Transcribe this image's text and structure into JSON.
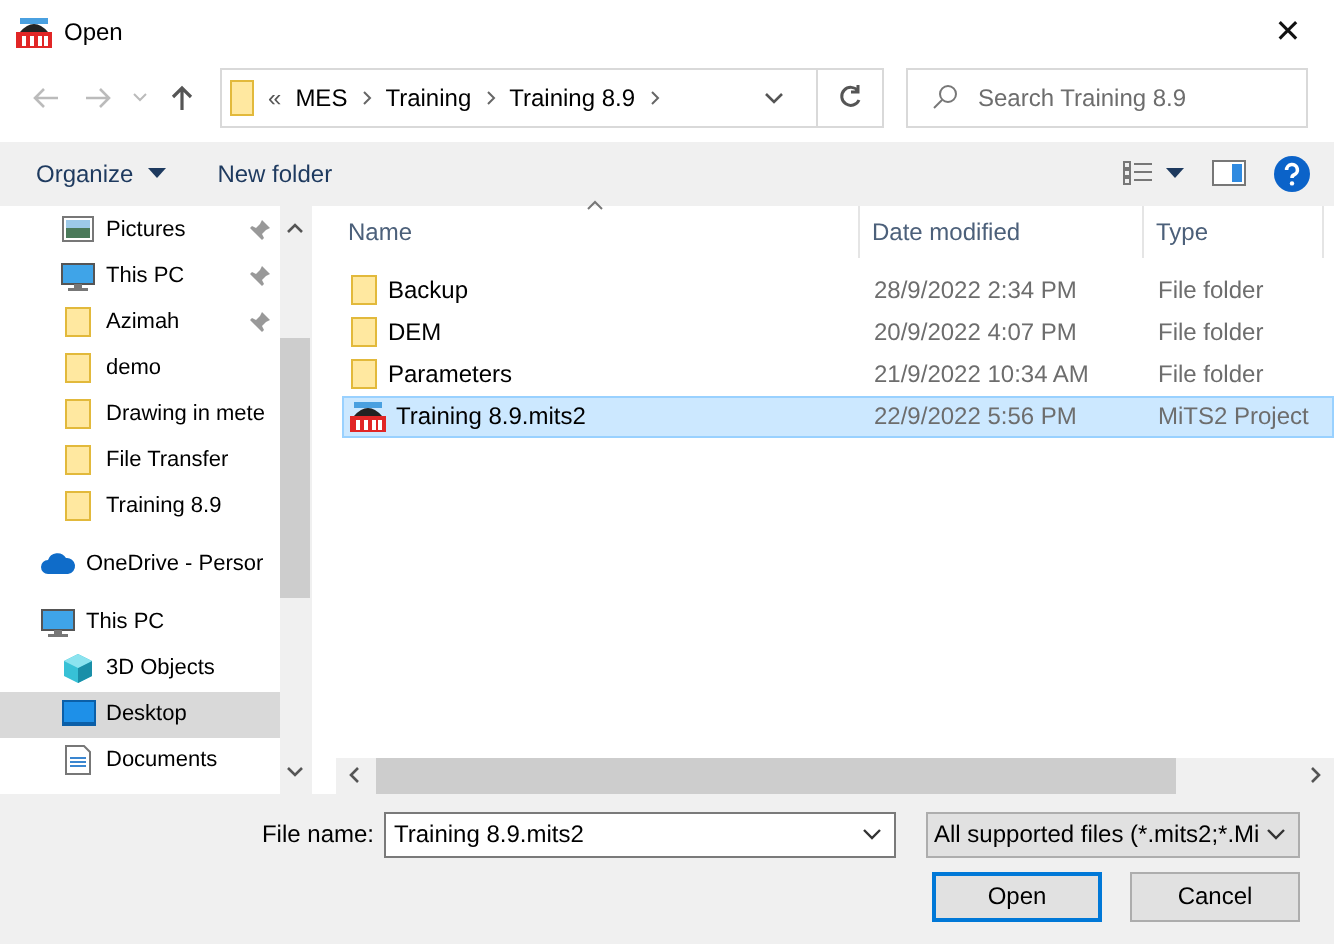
{
  "window": {
    "title": "Open",
    "close_glyph": "✕"
  },
  "navigation": {
    "breadcrumb_overflow": "«",
    "path": [
      "MES",
      "Training",
      "Training 8.9"
    ],
    "search": {
      "placeholder": "Search Training 8.9"
    }
  },
  "toolbar": {
    "organize": "Organize",
    "new_folder": "New folder"
  },
  "sidebar": {
    "quick_access": [
      {
        "label": "Pictures",
        "kind": "pictures",
        "pinned": true,
        "selected": false
      },
      {
        "label": "This PC",
        "kind": "pc",
        "pinned": true,
        "selected": false
      },
      {
        "label": "Azimah",
        "kind": "folder",
        "pinned": true,
        "selected": false
      },
      {
        "label": "demo",
        "kind": "folder",
        "pinned": false,
        "selected": false
      },
      {
        "label": "Drawing in mete",
        "kind": "folder",
        "pinned": false,
        "selected": false
      },
      {
        "label": "File Transfer",
        "kind": "folder",
        "pinned": false,
        "selected": false
      },
      {
        "label": "Training 8.9",
        "kind": "folder",
        "pinned": false,
        "selected": false
      }
    ],
    "items": [
      {
        "label": "OneDrive - Persor",
        "kind": "cloud",
        "selected": false
      },
      {
        "label": "This PC",
        "kind": "pc",
        "selected": false,
        "children": [
          {
            "label": "3D Objects",
            "kind": "cube",
            "selected": false
          },
          {
            "label": "Desktop",
            "kind": "desktop",
            "selected": true
          },
          {
            "label": "Documents",
            "kind": "documents",
            "selected": false
          }
        ]
      }
    ]
  },
  "table": {
    "columns": [
      "Name",
      "Date modified",
      "Type"
    ],
    "rows": [
      {
        "name": "Backup",
        "date_modified": "28/9/2022 2:34 PM",
        "type": "File folder",
        "kind": "folder",
        "selected": false
      },
      {
        "name": "DEM",
        "date_modified": "20/9/2022 4:07 PM",
        "type": "File folder",
        "kind": "folder",
        "selected": false
      },
      {
        "name": "Parameters",
        "date_modified": "21/9/2022 10:34 AM",
        "type": "File folder",
        "kind": "folder",
        "selected": false
      },
      {
        "name": "Training 8.9.mits2",
        "date_modified": "22/9/2022 5:56 PM",
        "type": "MiTS2 Project",
        "kind": "project",
        "selected": true
      }
    ]
  },
  "footer": {
    "file_name_label": "File name:",
    "file_name": "Training 8.9.mits2",
    "file_type": "All supported files (*.mits2;*.Mi",
    "buttons": [
      {
        "label": "Open",
        "default": true
      },
      {
        "label": "Cancel",
        "default": false
      }
    ]
  }
}
